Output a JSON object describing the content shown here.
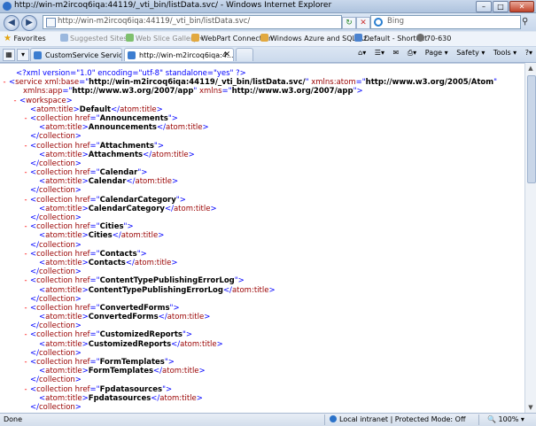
{
  "window": {
    "title": "http://win-m2ircoq6iqa:44119/_vti_bin/listData.svc/ - Windows Internet Explorer"
  },
  "address_bar": {
    "url": "http://win-m2ircoq6iqa:44119/_vti_bin/listData.svc/",
    "search_placeholder": "Bing"
  },
  "favorites_bar": {
    "favorites_label": "Favorites",
    "items": [
      {
        "label": "Suggested Sites ▾"
      },
      {
        "label": "Web Slice Gallery ▾"
      },
      {
        "label": "WebPart Connection"
      },
      {
        "label": "Windows Azure and SQL Az..."
      },
      {
        "label": "Default - Shortcut"
      },
      {
        "label": "70-630"
      }
    ]
  },
  "tabs": [
    {
      "label": "CustomService Service"
    },
    {
      "label": "http://win-m2ircoq6iqa:4..."
    }
  ],
  "command_bar": {
    "page": "Page ▾",
    "safety": "Safety ▾",
    "tools": "Tools ▾"
  },
  "xml": {
    "declaration": "<?xml version=\"1.0\" encoding=\"utf-8\" standalone=\"yes\" ?>",
    "service_base": "http://win-m2ircoq6iqa:44119/_vti_bin/listData.svc/",
    "atom_ns": "http://www.w3.org/2005/Atom",
    "app_ns": "http://www.w3.org/2007/app",
    "default_ns": "http://www.w3.org/2007/app",
    "workspace_title": "Default",
    "collections": [
      {
        "href": "Announcements",
        "title": "Announcements"
      },
      {
        "href": "Attachments",
        "title": "Attachments"
      },
      {
        "href": "Calendar",
        "title": "Calendar"
      },
      {
        "href": "CalendarCategory",
        "title": "CalendarCategory"
      },
      {
        "href": "Cities",
        "title": "Cities"
      },
      {
        "href": "Contacts",
        "title": "Contacts"
      },
      {
        "href": "ContentTypePublishingErrorLog",
        "title": "ContentTypePublishingErrorLog"
      },
      {
        "href": "ConvertedForms",
        "title": "ConvertedForms"
      },
      {
        "href": "CustomizedReports",
        "title": "CustomizedReports"
      },
      {
        "href": "FormTemplates",
        "title": "FormTemplates"
      },
      {
        "href": "Fpdatasources",
        "title": "Fpdatasources"
      }
    ]
  },
  "status_bar": {
    "status": "Done",
    "zone": "Local intranet | Protected Mode: Off",
    "zoom": "100%"
  }
}
